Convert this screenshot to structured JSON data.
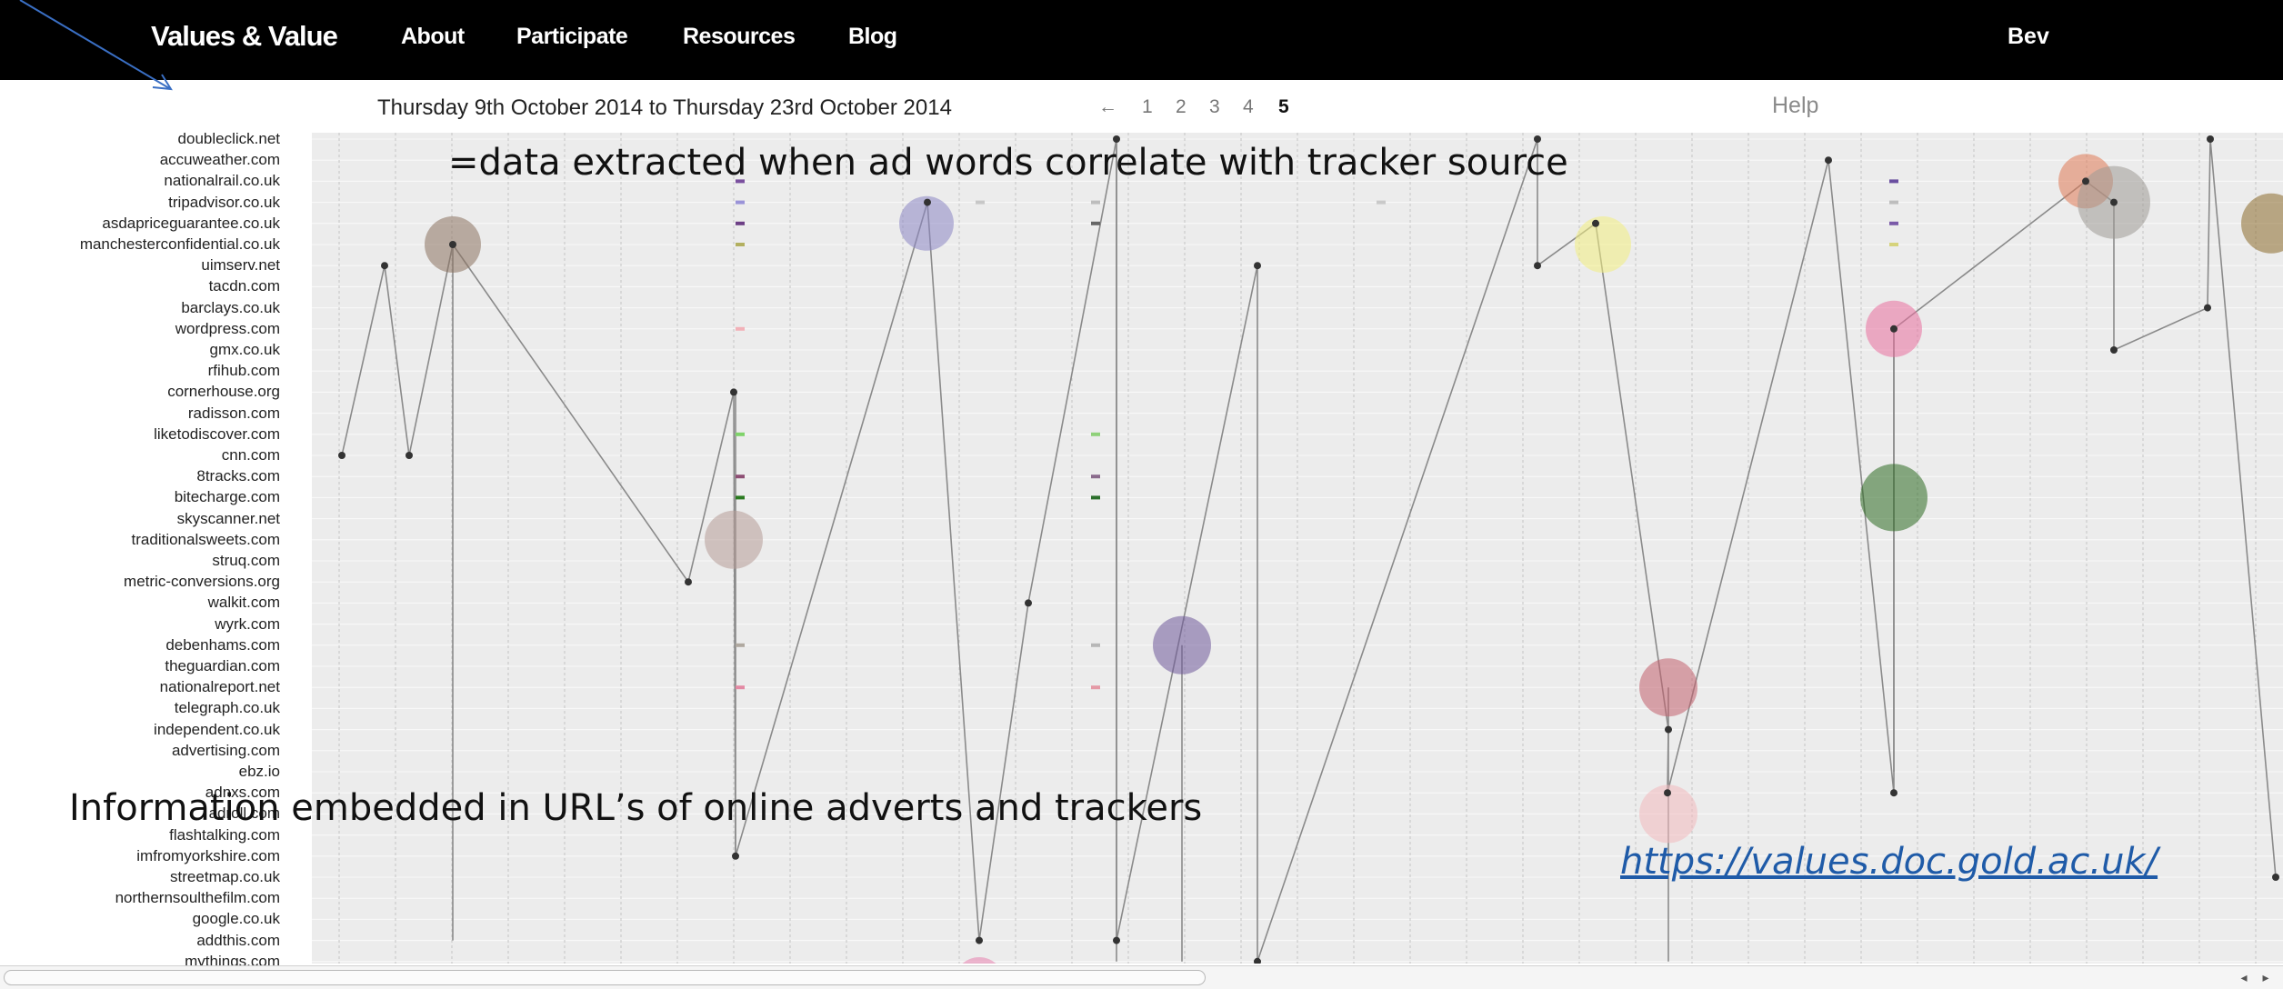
{
  "navbar": {
    "brand": "Values & Value",
    "links": [
      "About",
      "Participate",
      "Resources",
      "Blog"
    ],
    "user": "Bev"
  },
  "toolbar": {
    "date_range": "Thursday 9th October 2014 to Thursday 23rd October 2014",
    "prev_arrow": "←",
    "pages": [
      "1",
      "2",
      "3",
      "4",
      "5"
    ],
    "current_page": "5",
    "help": "Help"
  },
  "sites": [
    "doubleclick.net",
    "accuweather.com",
    "nationalrail.co.uk",
    "tripadvisor.co.uk",
    "asdapriceguarantee.co.uk",
    "manchesterconfidential.co.uk",
    "uimserv.net",
    "tacdn.com",
    "barclays.co.uk",
    "wordpress.com",
    "gmx.co.uk",
    "rfihub.com",
    "cornerhouse.org",
    "radisson.com",
    "liketodiscover.com",
    "cnn.com",
    "8tracks.com",
    "bitecharge.com",
    "skyscanner.net",
    "traditionalsweets.com",
    "struq.com",
    "metric-conversions.org",
    "walkit.com",
    "wyrk.com",
    "debenhams.com",
    "theguardian.com",
    "nationalreport.net",
    "telegraph.co.uk",
    "independent.co.uk",
    "advertising.com",
    "ebz.io",
    "adnxs.com",
    "adroll.com",
    "flashtalking.com",
    "imfromyorkshire.com",
    "streetmap.co.uk",
    "northernsoulthefilm.com",
    "google.co.uk",
    "addthis.com",
    "mythings.com"
  ],
  "annotations": {
    "top_caption": "=data extracted when ad words correlate with tracker source",
    "bottom_caption": "Information embedded in URL’s of online adverts and trackers",
    "url": "https://values.doc.gold.ac.uk/"
  },
  "colors": {
    "nav_bg": "#000000",
    "chart_bg": "#ececec",
    "line": "#8a8a8a",
    "link": "#1f5ba8"
  }
}
